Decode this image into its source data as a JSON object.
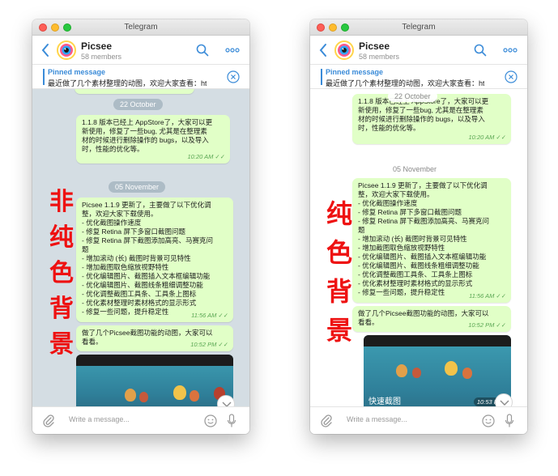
{
  "windows": [
    {
      "id": "left",
      "window_title": "Telegram",
      "chat": {
        "name": "Picsee",
        "members": "58 members"
      },
      "pinned": {
        "title": "Pinned message",
        "text": "最近做了几个素材整理的动图，欢迎大家查看：ht..."
      },
      "dates": [
        "22 October",
        "05 November"
      ],
      "messages": [
        {
          "lines": [
            "1.1.8 版本已经上 AppStore了，大家可以更",
            "新使用，修复了一些bug, 尤其是在整理素",
            "材的时候进行删除操作的 bugs，以及导入",
            "时，性能的优化等。"
          ],
          "time": "10:20 AM ✓✓"
        },
        {
          "lines": [
            "Picsee 1.1.9 更新了，主要做了以下优化调",
            "整，欢迎大家下载使用。",
            "- 优化截图操作速度",
            "- 修复 Retina 屏下多窗口截图问题",
            "- 修复 Retina 屏下截图添加高亮、马赛克问",
            "题",
            "- 增加滚动 (长) 截图时背景可见特性",
            "- 增加截图取色缩放视野特性",
            "- 优化编辑图片、截图插入文本框编辑功能",
            "- 优化编辑图片、截图线条粗细调整功能",
            "- 优化调整截图工具条、工具条上图标",
            "- 优化素材整理时素材格式的显示形式",
            "- 修复一些问题，提升稳定性"
          ],
          "time": "11:56 AM ✓✓"
        },
        {
          "lines": [
            "做了几个Picsee截图功能的动图，大家可以",
            "看看。"
          ],
          "time": "10:52 PM ✓✓"
        }
      ],
      "overlay": {
        "chars": [
          "非",
          "纯",
          "色",
          "背",
          "景"
        ],
        "color": "#ee1111"
      },
      "chat_background": "#d4dde3",
      "composer_placeholder": "Write a message..."
    },
    {
      "id": "right",
      "window_title": "Telegram",
      "chat": {
        "name": "Picsee",
        "members": "58 members"
      },
      "pinned": {
        "title": "Pinned message",
        "text": "最近做了几个素材整理的动图，欢迎大家查看：ht..."
      },
      "dates": [
        "22 October",
        "05 November"
      ],
      "messages": [
        {
          "lines": [
            "1.1.8 版本已经上 AppStore了，大家可以更",
            "新使用，修复了一些bug, 尤其是在整理素",
            "材的时候进行删除操作的 bugs，以及导入",
            "时，性能的优化等。"
          ],
          "time": "10:20 AM ✓✓"
        },
        {
          "lines": [
            "Picsee 1.1.9 更新了，主要做了以下优化调",
            "整，欢迎大家下载使用。",
            "- 优化截图操作速度",
            "- 修复 Retina 屏下多窗口截图问题",
            "- 修复 Retina 屏下截图添加高亮、马赛克问",
            "题",
            "- 增加滚动 (长) 截图时背景可见特性",
            "- 增加截图取色缩放视野特性",
            "- 优化编辑图片、截图插入文本框编辑功能",
            "- 优化编辑图片、截图线条粗细调整功能",
            "- 优化调整截图工具条、工具条上图标",
            "- 优化素材整理时素材格式的显示形式",
            "- 修复一些问题，提升稳定性"
          ],
          "time": "11:56 AM ✓✓"
        },
        {
          "lines": [
            "做了几个Picsee截图功能的动图，大家可以",
            "看看。"
          ],
          "time": "10:52 PM ✓✓"
        }
      ],
      "media": {
        "caption": "快速截图",
        "time": "10:53 PM"
      },
      "overlay": {
        "chars": [
          "纯",
          "色",
          "背",
          "景"
        ],
        "color": "#ee1111"
      },
      "chat_background": "#ffffff",
      "composer_placeholder": "Write a message..."
    }
  ]
}
